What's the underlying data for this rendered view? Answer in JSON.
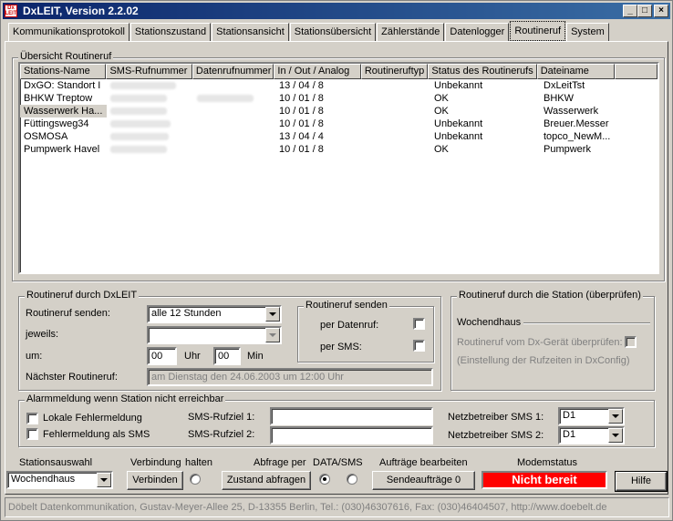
{
  "window": {
    "title": "DxLEIT, Version 2.2.02",
    "icon_text": "Dx LEIT"
  },
  "tabs": [
    {
      "label": "Kommunikationsprotokoll"
    },
    {
      "label": "Stationszustand"
    },
    {
      "label": "Stationsansicht"
    },
    {
      "label": "Stationsübersicht"
    },
    {
      "label": "Zählerstände"
    },
    {
      "label": "Datenlogger"
    },
    {
      "label": "Routineruf",
      "active": true
    },
    {
      "label": "System"
    }
  ],
  "overview": {
    "title": "Übersicht Routineruf",
    "columns": [
      "Stations-Name",
      "SMS-Rufnummer",
      "Datenrufnummer",
      "In / Out / Analog",
      "Routineruftyp",
      "Status des Routinerufs",
      "Dateiname"
    ],
    "rows": [
      {
        "name": "DxGO: Standort I",
        "io": "13 / 04 / 8",
        "type": "",
        "status": "Unbekannt",
        "file": "DxLeitTst"
      },
      {
        "name": "BHKW Treptow",
        "io": "10 / 01 / 8",
        "type": "",
        "status": "OK",
        "file": "BHKW"
      },
      {
        "name": "Wasserwerk Ha...",
        "io": "10 / 01 / 8",
        "type": "",
        "status": "OK",
        "file": "Wasserwerk",
        "selected": true
      },
      {
        "name": "Füttingsweg34",
        "io": "10 / 01 / 8",
        "type": "",
        "status": "Unbekannt",
        "file": "Breuer.Messer"
      },
      {
        "name": "OSMOSA",
        "io": "13 / 04 / 4",
        "type": "",
        "status": "Unbekannt",
        "file": "topco_NewM..."
      },
      {
        "name": "Pumpwerk Havel",
        "io": "10 / 01 / 8",
        "type": "",
        "status": "OK",
        "file": "Pumpwerk"
      }
    ]
  },
  "routine_dxleit": {
    "title": "Routineruf durch DxLEIT",
    "send_label": "Routineruf senden:",
    "send_value": "alle 12 Stunden",
    "each_label": "jeweils:",
    "each_value": "",
    "at_label": "um:",
    "hour_value": "00",
    "hour_unit": "Uhr",
    "min_value": "00",
    "min_unit": "Min",
    "next_label": "Nächster Routineruf:",
    "next_value": "am Dienstag den 24.06.2003 um 12:00 Uhr",
    "send_group": {
      "title": "Routineruf senden",
      "data_label": "per Datenruf:",
      "sms_label": "per SMS:"
    }
  },
  "routine_station": {
    "title": "Routineruf durch die Station (überprüfen)",
    "station": "Wochendhaus",
    "check_label": "Routineruf vom Dx-Gerät überprüfen:",
    "hint": "(Einstellung der Rufzeiten in DxConfig)"
  },
  "alarm": {
    "title": "Alarmmeldung wenn Station nicht erreichbar",
    "local_label": "Lokale Fehlermeldung",
    "sms_label": "Fehlermeldung als SMS",
    "target1_label": "SMS-Rufziel 1:",
    "target2_label": "SMS-Rufziel 2:",
    "target1_value": "",
    "target2_value": "",
    "net1_label": "Netzbetreiber SMS 1:",
    "net2_label": "Netzbetreiber SMS 2:",
    "net1_value": "D1",
    "net2_value": "D1"
  },
  "bottom": {
    "station_label": "Stationsauswahl",
    "station_value": "Wochendhaus",
    "connection_label": "Verbindung",
    "hold_label": "halten",
    "connect_button": "Verbinden",
    "query_label": "Abfrage per",
    "data_sms_label": "DATA/SMS",
    "query_button": "Zustand abfragen",
    "jobs_label": "Aufträge bearbeiten",
    "jobs_button": "Sendeaufträge 0",
    "modem_label": "Modemstatus",
    "modem_status": "Nicht bereit",
    "modem_color": "#ff0000",
    "help_button": "Hilfe"
  },
  "footer": {
    "text": "Döbelt Datenkommunikation, Gustav-Meyer-Allee 25, D-13355 Berlin, Tel.: (030)46307616, Fax: (030)46404507, http://www.doebelt.de"
  }
}
